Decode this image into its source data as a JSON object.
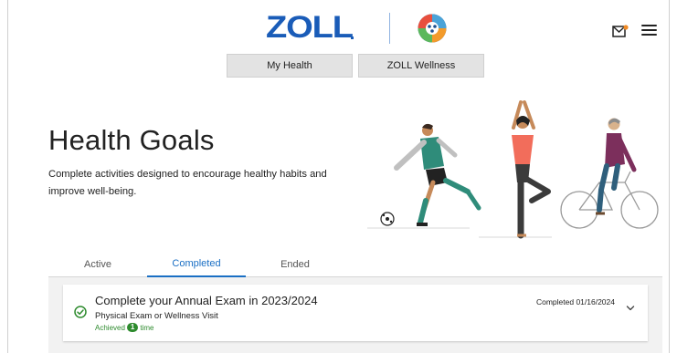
{
  "header": {
    "brand": "ZOLL",
    "nav": [
      {
        "label": "My Health"
      },
      {
        "label": "ZOLL Wellness"
      }
    ]
  },
  "hero": {
    "title": "Health Goals",
    "subtitle": "Complete activities designed to encourage healthy habits and improve well-being."
  },
  "tabs": [
    {
      "label": "Active",
      "selected": false
    },
    {
      "label": "Completed",
      "selected": true
    },
    {
      "label": "Ended",
      "selected": false
    }
  ],
  "goals": [
    {
      "title": "Complete your Annual Exam in 2023/2024",
      "category": "Physical Exam or Wellness Visit",
      "achieved_prefix": "Achieved",
      "achieved_count": "1",
      "achieved_suffix": "time",
      "status": "Completed 01/16/2024"
    }
  ],
  "colors": {
    "brand_blue": "#1a5cb8",
    "tab_accent": "#1a6fc4",
    "success_green": "#2e8b2e",
    "notification_orange": "#f08a24"
  },
  "icons": [
    "mail-icon",
    "menu-icon",
    "check-circle-icon",
    "chevron-down-icon"
  ]
}
